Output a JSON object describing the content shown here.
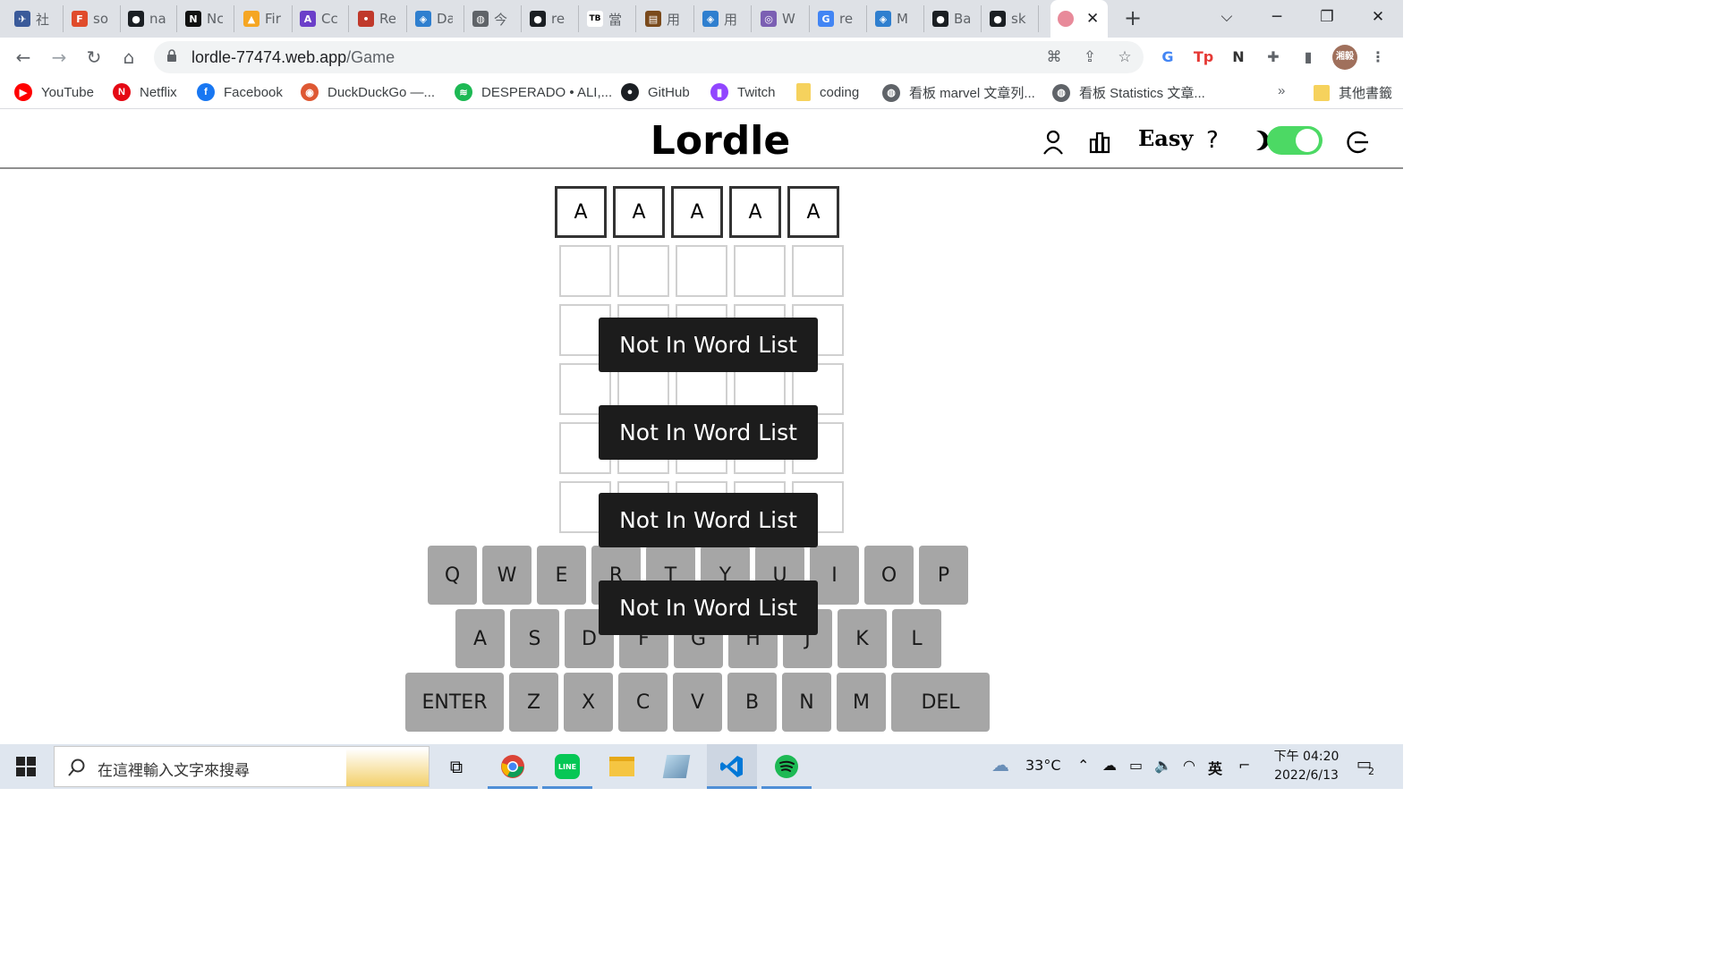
{
  "browser": {
    "tabs": [
      {
        "title": "社",
        "fav_color": "#3a5a9a",
        "fav_glyph": "✈"
      },
      {
        "title": "so",
        "fav_color": "#e04b2b",
        "fav_glyph": "F"
      },
      {
        "title": "na",
        "fav_color": "#1b1f23",
        "fav_glyph": "●"
      },
      {
        "title": "Nc",
        "fav_color": "#111111",
        "fav_glyph": "N"
      },
      {
        "title": "Fir",
        "fav_color": "#f5a623",
        "fav_glyph": "▲"
      },
      {
        "title": "Cc",
        "fav_color": "#6b3fc9",
        "fav_glyph": "A"
      },
      {
        "title": "Re",
        "fav_color": "#c0392b",
        "fav_glyph": "•"
      },
      {
        "title": "Da",
        "fav_color": "#2f7fcf",
        "fav_glyph": "◈"
      },
      {
        "title": "今",
        "fav_color": "#5f6368",
        "fav_glyph": "◍"
      },
      {
        "title": "re",
        "fav_color": "#1b1f23",
        "fav_glyph": "●"
      },
      {
        "title": "當",
        "fav_color": "#ffffff",
        "fav_glyph": "TB"
      },
      {
        "title": "用",
        "fav_color": "#7a4a1c",
        "fav_glyph": "▤"
      },
      {
        "title": "用",
        "fav_color": "#2f7fcf",
        "fav_glyph": "◈"
      },
      {
        "title": "W",
        "fav_color": "#7b5fb3",
        "fav_glyph": "◎"
      },
      {
        "title": "re",
        "fav_color": "#4285f4",
        "fav_glyph": "G"
      },
      {
        "title": "M",
        "fav_color": "#2f7fcf",
        "fav_glyph": "◈"
      },
      {
        "title": "Ba",
        "fav_color": "#1b1f23",
        "fav_glyph": "●"
      },
      {
        "title": "sk",
        "fav_color": "#1b1f23",
        "fav_glyph": "●"
      }
    ],
    "active_tab": {
      "close": "✕",
      "fav_color": "#e88a9a"
    },
    "url_host": "lordle-77474.web.app",
    "url_path": "/Game",
    "window": {
      "minimize": "─",
      "restore": "❐",
      "close": "✕",
      "menu": "⌵"
    },
    "avatar_text": "湘毅",
    "bookmarks": [
      {
        "label": "YouTube",
        "color": "#ff0000",
        "glyph": "▶"
      },
      {
        "label": "Netflix",
        "color": "#e50914",
        "glyph": "N"
      },
      {
        "label": "Facebook",
        "color": "#1877f2",
        "glyph": "f"
      },
      {
        "label": "DuckDuckGo —...",
        "color": "#de5833",
        "glyph": "◉"
      },
      {
        "label": "DESPERADO • ALI,...",
        "color": "#1db954",
        "glyph": "≋"
      },
      {
        "label": "GitHub",
        "color": "#1b1f23",
        "glyph": "●"
      },
      {
        "label": "Twitch",
        "color": "#9146ff",
        "glyph": "▮"
      },
      {
        "label": "coding",
        "color": "#f6d25d",
        "glyph": ""
      },
      {
        "label": "看板 marvel 文章列...",
        "color": "#5f6368",
        "glyph": "◍"
      },
      {
        "label": "看板 Statistics 文章...",
        "color": "#5f6368",
        "glyph": "◍"
      }
    ],
    "bookmarks_overflow": "»",
    "other_bookmarks": "其他書籤"
  },
  "game": {
    "title": "Lordle",
    "mode_label": "Easy",
    "help_label": "?",
    "dark_mode_on": true,
    "board": {
      "rows": [
        [
          "A",
          "A",
          "A",
          "A",
          "A"
        ],
        [
          "",
          "",
          "",
          "",
          ""
        ],
        [
          "",
          "",
          "",
          "",
          ""
        ],
        [
          "",
          "",
          "",
          "",
          ""
        ],
        [
          "",
          "",
          "",
          "",
          ""
        ],
        [
          "",
          "",
          "",
          "",
          ""
        ]
      ]
    },
    "toasts": [
      "Not In Word List",
      "Not In Word List",
      "Not In Word List",
      "Not In Word List"
    ],
    "keyboard": {
      "row1": [
        "Q",
        "W",
        "E",
        "R",
        "T",
        "Y",
        "U",
        "I",
        "O",
        "P"
      ],
      "row2": [
        "A",
        "S",
        "D",
        "F",
        "G",
        "H",
        "J",
        "K",
        "L"
      ],
      "row3": [
        "ENTER",
        "Z",
        "X",
        "C",
        "V",
        "B",
        "N",
        "M",
        "DEL"
      ]
    },
    "colors": {
      "key_bg": "#a6a6a6",
      "toast_bg": "#1c1c1c",
      "toggle_on": "#4cd964"
    }
  },
  "taskbar": {
    "search_placeholder": "在這裡輸入文字來搜尋",
    "weather": "33°C",
    "ime": "英",
    "time": "下午 04:20",
    "date": "2022/6/13",
    "notifications": "2"
  }
}
